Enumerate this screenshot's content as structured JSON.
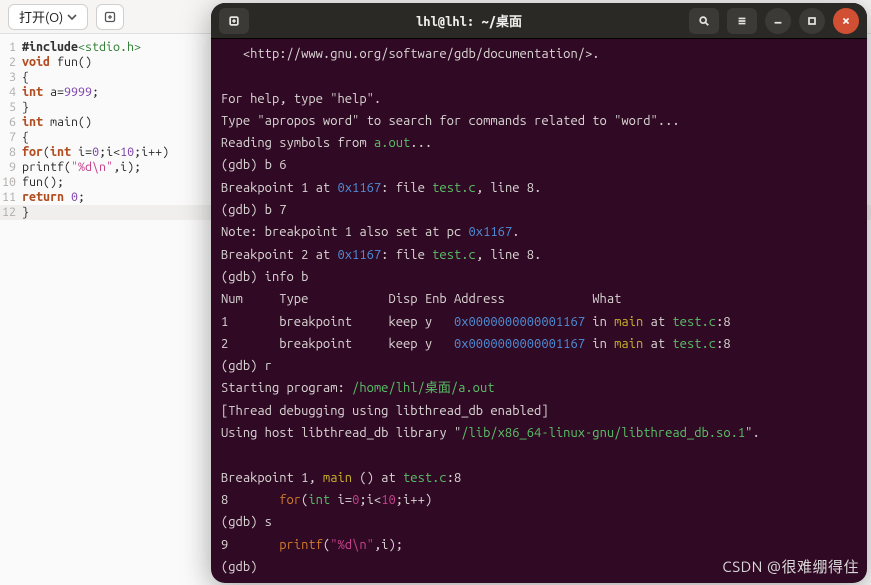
{
  "editor": {
    "open_label": "打开(O)",
    "lines": [
      {
        "n": 1,
        "segs": [
          {
            "t": "#include",
            "c": "inc"
          },
          {
            "t": "<stdio.h>",
            "c": "hdr"
          }
        ]
      },
      {
        "n": 2,
        "segs": [
          {
            "t": "void",
            "c": "kw"
          },
          {
            "t": " fun()",
            "c": "txt"
          }
        ]
      },
      {
        "n": 3,
        "segs": [
          {
            "t": "{",
            "c": "txt"
          }
        ]
      },
      {
        "n": 4,
        "segs": [
          {
            "t": "int",
            "c": "kw"
          },
          {
            "t": " a=",
            "c": "txt"
          },
          {
            "t": "9999",
            "c": "num"
          },
          {
            "t": ";",
            "c": "txt"
          }
        ]
      },
      {
        "n": 5,
        "segs": [
          {
            "t": "}",
            "c": "txt"
          }
        ]
      },
      {
        "n": 6,
        "segs": [
          {
            "t": "int",
            "c": "kw"
          },
          {
            "t": " main()",
            "c": "txt"
          }
        ]
      },
      {
        "n": 7,
        "segs": [
          {
            "t": "{",
            "c": "txt"
          }
        ]
      },
      {
        "n": 8,
        "segs": [
          {
            "t": "for",
            "c": "kw"
          },
          {
            "t": "(",
            "c": "txt"
          },
          {
            "t": "int",
            "c": "kw"
          },
          {
            "t": " i=",
            "c": "txt"
          },
          {
            "t": "0",
            "c": "num"
          },
          {
            "t": ";i<",
            "c": "txt"
          },
          {
            "t": "10",
            "c": "num"
          },
          {
            "t": ";i++)",
            "c": "txt"
          }
        ]
      },
      {
        "n": 9,
        "segs": [
          {
            "t": "printf(",
            "c": "txt"
          },
          {
            "t": "\"%d",
            "c": "str"
          },
          {
            "t": "\\n",
            "c": "str"
          },
          {
            "t": "\"",
            "c": "str"
          },
          {
            "t": ",i);",
            "c": "txt"
          }
        ]
      },
      {
        "n": 10,
        "segs": [
          {
            "t": "fun();",
            "c": "txt"
          }
        ]
      },
      {
        "n": 11,
        "segs": [
          {
            "t": "return",
            "c": "kw"
          },
          {
            "t": " ",
            "c": "txt"
          },
          {
            "t": "0",
            "c": "num"
          },
          {
            "t": ";",
            "c": "txt"
          }
        ]
      },
      {
        "n": 12,
        "hl": true,
        "segs": [
          {
            "t": "}",
            "c": "txt"
          }
        ]
      }
    ]
  },
  "terminal": {
    "title": "lhl@lhl: ~/桌面",
    "lines": [
      [
        {
          "t": "   <http://www.gnu.org/software/gdb/documentation/>.",
          "c": "c-dim"
        }
      ],
      [
        {
          "t": "",
          "c": "c-dim"
        }
      ],
      [
        {
          "t": "For help, type \"help\".",
          "c": "c-dim"
        }
      ],
      [
        {
          "t": "Type \"apropos word\" to search for commands related to \"word\"...",
          "c": "c-dim"
        }
      ],
      [
        {
          "t": "Reading symbols from ",
          "c": "c-dim"
        },
        {
          "t": "a.out",
          "c": "c-green"
        },
        {
          "t": "...",
          "c": "c-dim"
        }
      ],
      [
        {
          "t": "(gdb) b 6",
          "c": "c-dim"
        }
      ],
      [
        {
          "t": "Breakpoint 1 at ",
          "c": "c-dim"
        },
        {
          "t": "0x1167",
          "c": "c-blue"
        },
        {
          "t": ": file ",
          "c": "c-dim"
        },
        {
          "t": "test.c",
          "c": "c-green"
        },
        {
          "t": ", line 8.",
          "c": "c-dim"
        }
      ],
      [
        {
          "t": "(gdb) b 7",
          "c": "c-dim"
        }
      ],
      [
        {
          "t": "Note: breakpoint 1 also set at pc ",
          "c": "c-dim"
        },
        {
          "t": "0x1167",
          "c": "c-blue"
        },
        {
          "t": ".",
          "c": "c-dim"
        }
      ],
      [
        {
          "t": "Breakpoint 2 at ",
          "c": "c-dim"
        },
        {
          "t": "0x1167",
          "c": "c-blue"
        },
        {
          "t": ": file ",
          "c": "c-dim"
        },
        {
          "t": "test.c",
          "c": "c-green"
        },
        {
          "t": ", line 8.",
          "c": "c-dim"
        }
      ],
      [
        {
          "t": "(gdb) info b",
          "c": "c-dim"
        }
      ],
      [
        {
          "t": "Num     Type           Disp Enb Address            What",
          "c": "c-dim"
        }
      ],
      [
        {
          "t": "1       breakpoint     keep y   ",
          "c": "c-dim"
        },
        {
          "t": "0x0000000000001167",
          "c": "c-blue"
        },
        {
          "t": " in ",
          "c": "c-dim"
        },
        {
          "t": "main",
          "c": "c-yellow"
        },
        {
          "t": " at ",
          "c": "c-dim"
        },
        {
          "t": "test.c",
          "c": "c-green"
        },
        {
          "t": ":8",
          "c": "c-dim"
        }
      ],
      [
        {
          "t": "2       breakpoint     keep y   ",
          "c": "c-dim"
        },
        {
          "t": "0x0000000000001167",
          "c": "c-blue"
        },
        {
          "t": " in ",
          "c": "c-dim"
        },
        {
          "t": "main",
          "c": "c-yellow"
        },
        {
          "t": " at ",
          "c": "c-dim"
        },
        {
          "t": "test.c",
          "c": "c-green"
        },
        {
          "t": ":8",
          "c": "c-dim"
        }
      ],
      [
        {
          "t": "(gdb) r",
          "c": "c-dim"
        }
      ],
      [
        {
          "t": "Starting program: ",
          "c": "c-dim"
        },
        {
          "t": "/home/lhl/桌面/a.out",
          "c": "c-green"
        }
      ],
      [
        {
          "t": "[Thread debugging using libthread_db enabled]",
          "c": "c-dim"
        }
      ],
      [
        {
          "t": "Using host libthread_db library \"",
          "c": "c-dim"
        },
        {
          "t": "/lib/x86_64-linux-gnu/libthread_db.so.1",
          "c": "c-green"
        },
        {
          "t": "\".",
          "c": "c-dim"
        }
      ],
      [
        {
          "t": "",
          "c": "c-dim"
        }
      ],
      [
        {
          "t": "Breakpoint 1, ",
          "c": "c-dim"
        },
        {
          "t": "main",
          "c": "c-yellow"
        },
        {
          "t": " () at ",
          "c": "c-dim"
        },
        {
          "t": "test.c",
          "c": "c-green"
        },
        {
          "t": ":8",
          "c": "c-dim"
        }
      ],
      [
        {
          "t": "8       ",
          "c": "c-dim"
        },
        {
          "t": "for",
          "c": "c-orange"
        },
        {
          "t": "(",
          "c": "c-dim"
        },
        {
          "t": "int",
          "c": "c-green"
        },
        {
          "t": " i=",
          "c": "c-dim"
        },
        {
          "t": "0",
          "c": "c-mag"
        },
        {
          "t": ";i<",
          "c": "c-dim"
        },
        {
          "t": "10",
          "c": "c-mag"
        },
        {
          "t": ";i++)",
          "c": "c-dim"
        }
      ],
      [
        {
          "t": "(gdb) s",
          "c": "c-dim"
        }
      ],
      [
        {
          "t": "9       ",
          "c": "c-dim"
        },
        {
          "t": "printf",
          "c": "c-orange"
        },
        {
          "t": "(",
          "c": "c-dim"
        },
        {
          "t": "\"%d\\n\"",
          "c": "c-mag"
        },
        {
          "t": ",i);",
          "c": "c-dim"
        }
      ],
      [
        {
          "t": "(gdb) ",
          "c": "c-dim"
        }
      ]
    ]
  },
  "watermark": "CSDN @很难绷得住"
}
